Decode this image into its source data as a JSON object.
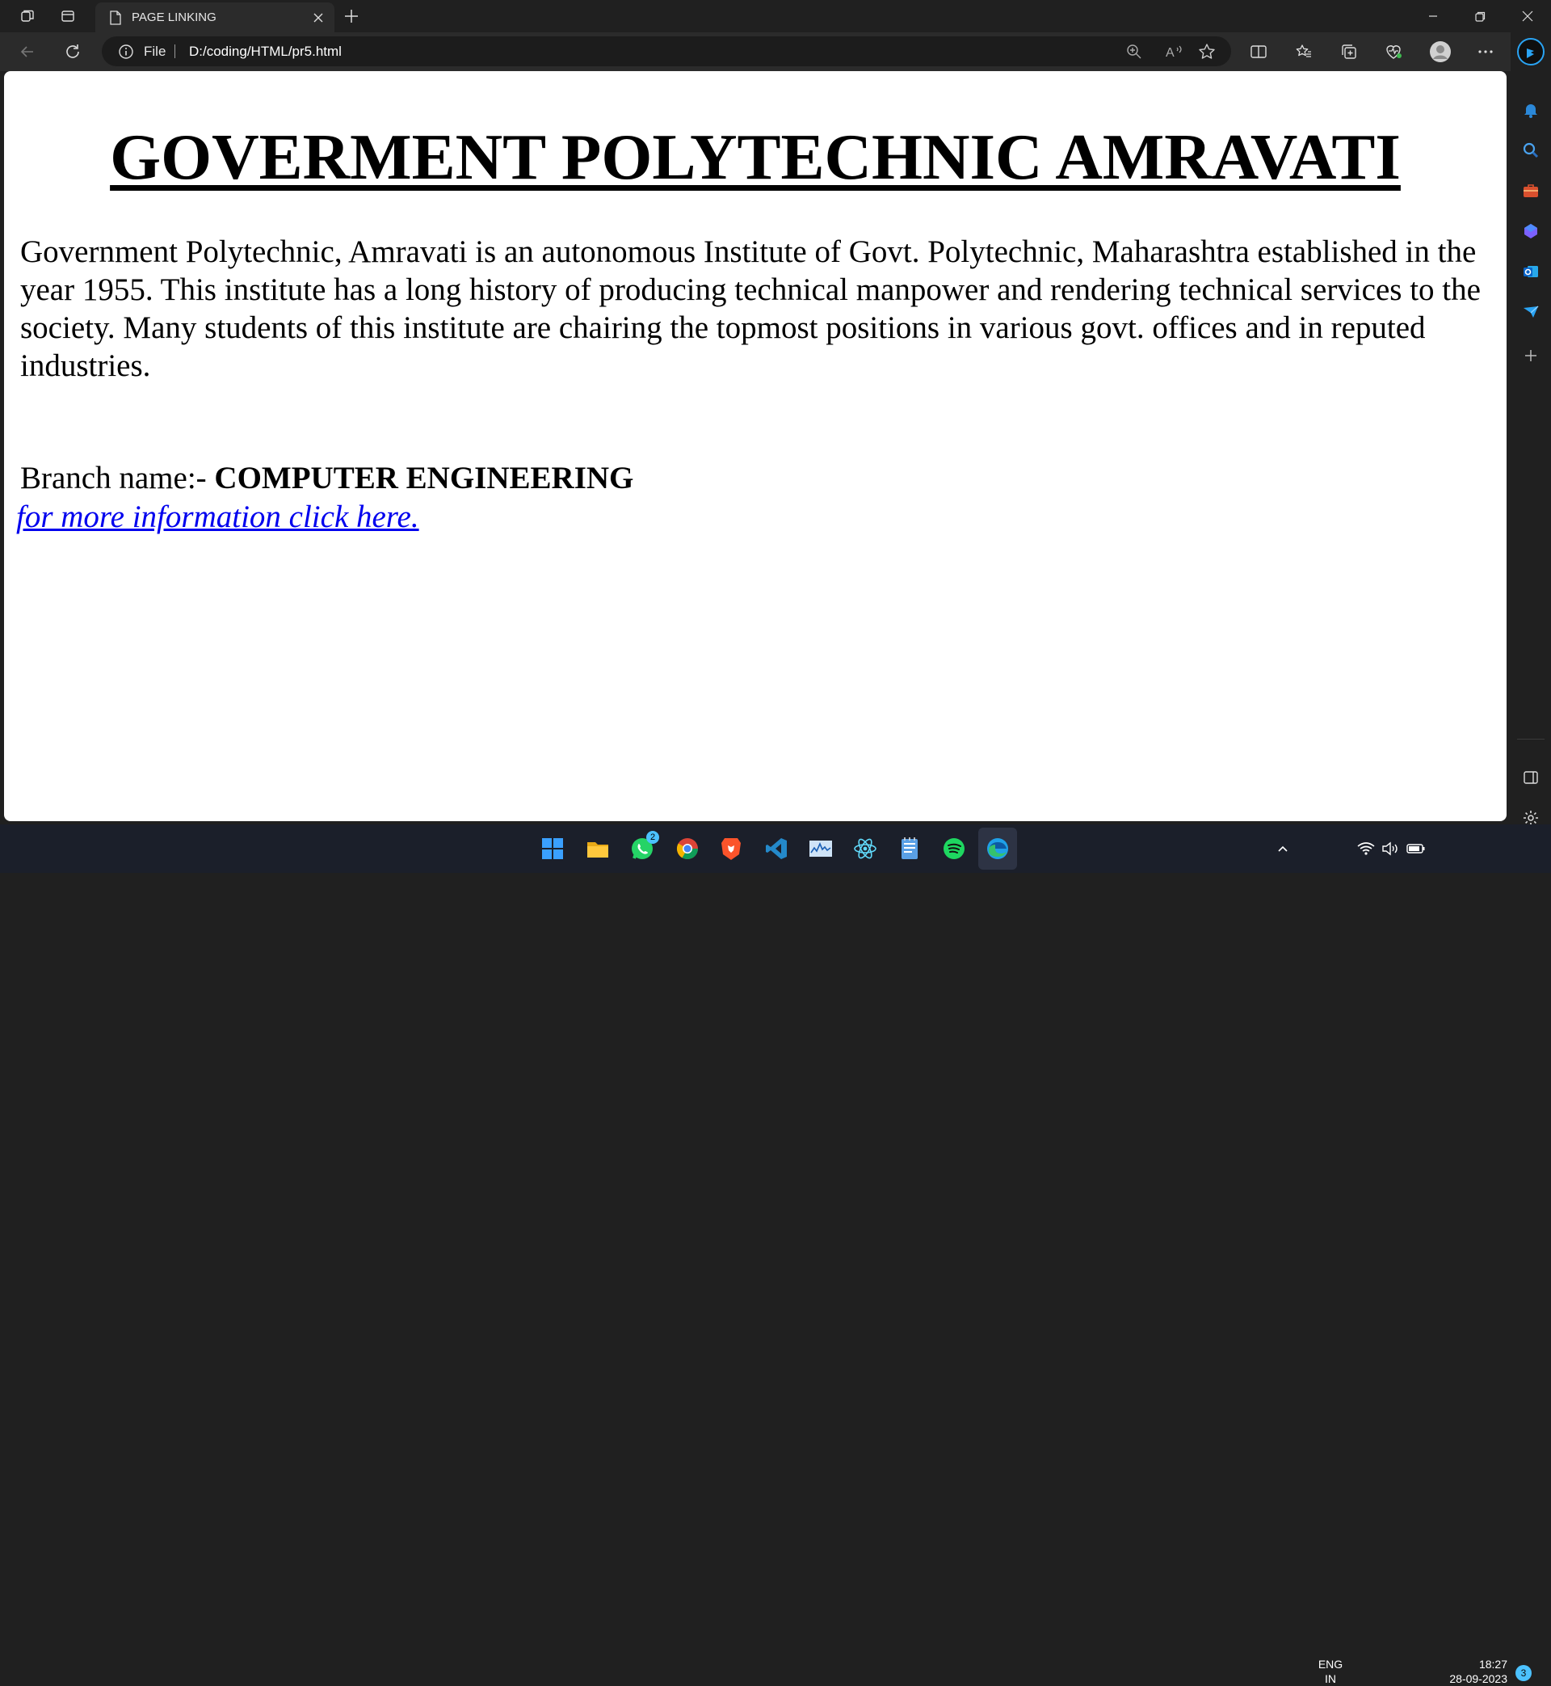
{
  "browser": {
    "tab_title": "PAGE LINKING",
    "address": {
      "scheme_label": "File",
      "url": "D:/coding/HTML/pr5.html"
    }
  },
  "page": {
    "heading": "GOVERMENT POLYTECHNIC AMRAVATI",
    "intro": "Government Polytechnic, Amravati is an autonomous Institute of Govt. Polytechnic, Maharashtra established in the year 1955. This institute has a long history of producing technical manpower and rendering technical services to the society. Many students of this institute are chairing the topmost positions in various govt. offices and in reputed industries.",
    "branch_label": "Branch name:-",
    "branch_value": "COMPUTER ENGINEERING",
    "link_text": "for more information click here."
  },
  "taskbar": {
    "whatsapp_badge": "2",
    "language": "ENG",
    "region": "IN",
    "time": "18:27",
    "date": "28-09-2023",
    "notification_count": "3"
  },
  "colors": {
    "link": "#0000ee",
    "bing_accent": "#2aa4f4",
    "taskbar_bg": "#1b1f2a"
  }
}
